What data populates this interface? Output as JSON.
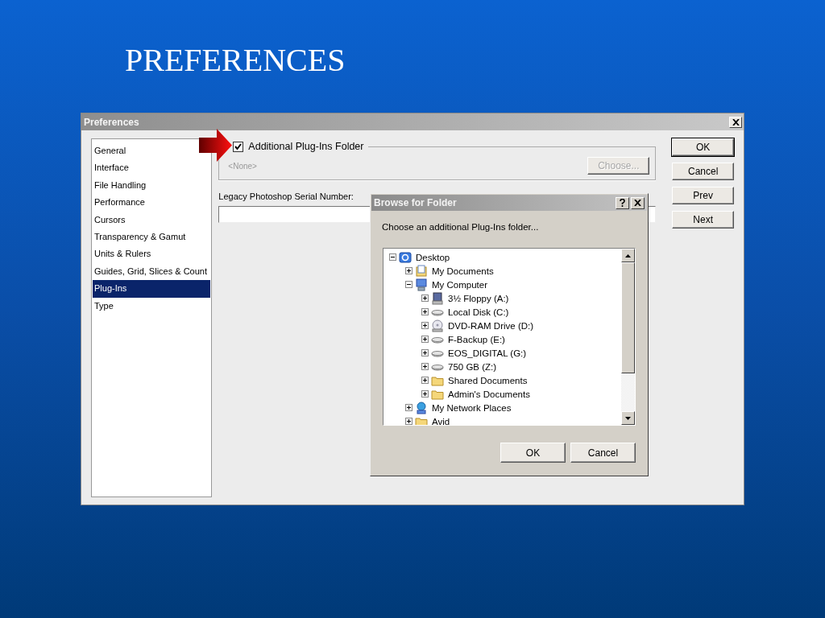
{
  "slide": {
    "title": "PREFERENCES"
  },
  "preferences": {
    "title": "Preferences",
    "categories": [
      {
        "label": "General",
        "selected": false
      },
      {
        "label": "Interface",
        "selected": false
      },
      {
        "label": "File Handling",
        "selected": false
      },
      {
        "label": "Performance",
        "selected": false
      },
      {
        "label": "Cursors",
        "selected": false
      },
      {
        "label": "Transparency & Gamut",
        "selected": false
      },
      {
        "label": "Units & Rulers",
        "selected": false
      },
      {
        "label": "Guides, Grid, Slices & Count",
        "selected": false
      },
      {
        "label": "Plug-Ins",
        "selected": true
      },
      {
        "label": "Type",
        "selected": false
      }
    ],
    "plugins_group": {
      "checkbox": {
        "label": "Additional Plug-Ins Folder",
        "checked": true
      },
      "path": "<None>",
      "choose_button": {
        "label": "Choose...",
        "disabled": true
      }
    },
    "serial": {
      "label": "Legacy Photoshop Serial Number:"
    },
    "buttons": [
      {
        "label": "OK",
        "default": true
      },
      {
        "label": "Cancel",
        "default": false
      },
      {
        "label": "Prev",
        "default": false
      },
      {
        "label": "Next",
        "default": false
      }
    ]
  },
  "browse_dialog": {
    "title": "Browse for Folder",
    "prompt": "Choose an additional Plug-Ins folder...",
    "tree": [
      {
        "label": "Desktop",
        "kind": "desktop",
        "expanded": true,
        "children": [
          {
            "label": "My Documents",
            "kind": "documents",
            "expanded": false
          },
          {
            "label": "My Computer",
            "kind": "computer",
            "expanded": true,
            "children": [
              {
                "label": "3½ Floppy (A:)",
                "kind": "floppy",
                "expanded": false
              },
              {
                "label": "Local Disk (C:)",
                "kind": "disk",
                "expanded": false
              },
              {
                "label": "DVD-RAM Drive (D:)",
                "kind": "dvd",
                "expanded": false
              },
              {
                "label": "F-Backup (E:)",
                "kind": "disk",
                "expanded": false
              },
              {
                "label": "EOS_DIGITAL (G:)",
                "kind": "disk",
                "expanded": false
              },
              {
                "label": "750 GB (Z:)",
                "kind": "disk",
                "expanded": false
              },
              {
                "label": "Shared Documents",
                "kind": "folder",
                "expanded": false
              },
              {
                "label": "Admin's Documents",
                "kind": "folder",
                "expanded": false
              }
            ]
          },
          {
            "label": "My Network Places",
            "kind": "network",
            "expanded": false
          },
          {
            "label": "Avid",
            "kind": "folder",
            "expanded": false
          }
        ]
      }
    ],
    "buttons": [
      "OK",
      "Cancel"
    ]
  }
}
